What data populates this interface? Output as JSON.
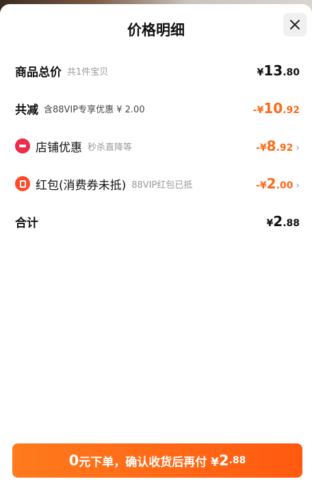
{
  "header": {
    "title": "价格明细"
  },
  "rows": {
    "subtotal": {
      "label": "商品总价",
      "note": "共1件宝贝",
      "currency": "¥",
      "int": "13",
      "dec": ".80"
    },
    "reduction": {
      "label": "共减",
      "note": "含88VIP专享优惠 ¥ 2.00",
      "prefix": "-¥",
      "int": "10",
      "dec": ".92"
    },
    "shop_discount": {
      "label": "店铺优惠",
      "note": "秒杀直降等",
      "prefix": "-¥",
      "int": "8",
      "dec": ".92"
    },
    "red_packet": {
      "label": "红包(消费券未抵)",
      "note": "88VIP红包已抵",
      "prefix": "-¥",
      "int": "2",
      "dec": ".00"
    },
    "total": {
      "label": "合计",
      "currency": "¥",
      "int": "2",
      "dec": ".88"
    }
  },
  "cta": {
    "pre_big": "0",
    "pre_text": "元下单，确认收货后再付 ¥",
    "int": "2",
    "dec": ".88"
  },
  "icons": {
    "close": "close-icon",
    "shop": "shop-discount-icon",
    "packet": "red-packet-icon",
    "chevron": "chevron-right-icon"
  },
  "colors": {
    "accent": "#ff6a1a",
    "shop_icon": "#ee2b4b",
    "packet_icon": "#ff4a2b"
  }
}
